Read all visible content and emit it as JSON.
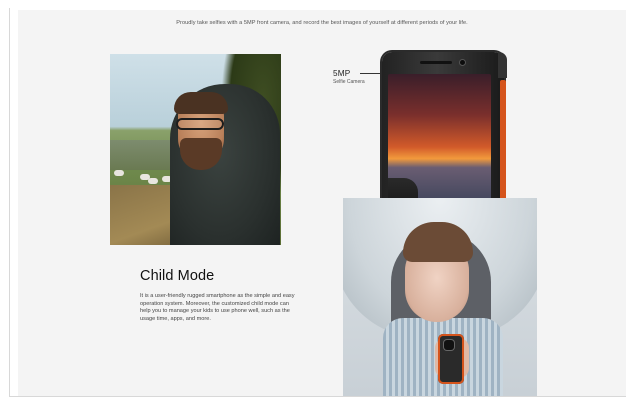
{
  "tagline": "Proudly take selfies with a 5MP front camera, and record the best images of yourself at different periods of your life.",
  "camera": {
    "title": "5MP",
    "subtitle": "Selfie Camera"
  },
  "child_mode": {
    "title": "Child Mode",
    "description": "It is a user-friendly rugged smartphone as the simple and easy operation system. Moreover, the customized child mode can help you to manage your kids to use phone well, such as the usage time, apps, and more."
  },
  "colors": {
    "panel_bg": "#f4f4f4",
    "accent_orange": "#d5541c",
    "text_dark": "#111111",
    "text_muted": "#444444"
  }
}
